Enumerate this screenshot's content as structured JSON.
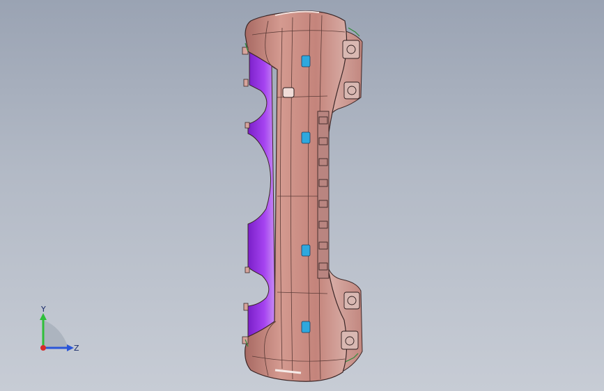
{
  "viewport": {
    "background_top": "#9aa3b3",
    "background_bottom": "#c7ccd5"
  },
  "model": {
    "body_color": "#c98e86",
    "body_shadow": "#b4766f",
    "inner_color": "#9b30e6",
    "clip_color": "#2ea8de",
    "edge_color": "#3a2626"
  },
  "triad": {
    "y_label": "Y",
    "z_label": "Z",
    "y_color": "#2fbf3a",
    "z_color": "#2a55d8",
    "x_color": "#d82a2a"
  }
}
